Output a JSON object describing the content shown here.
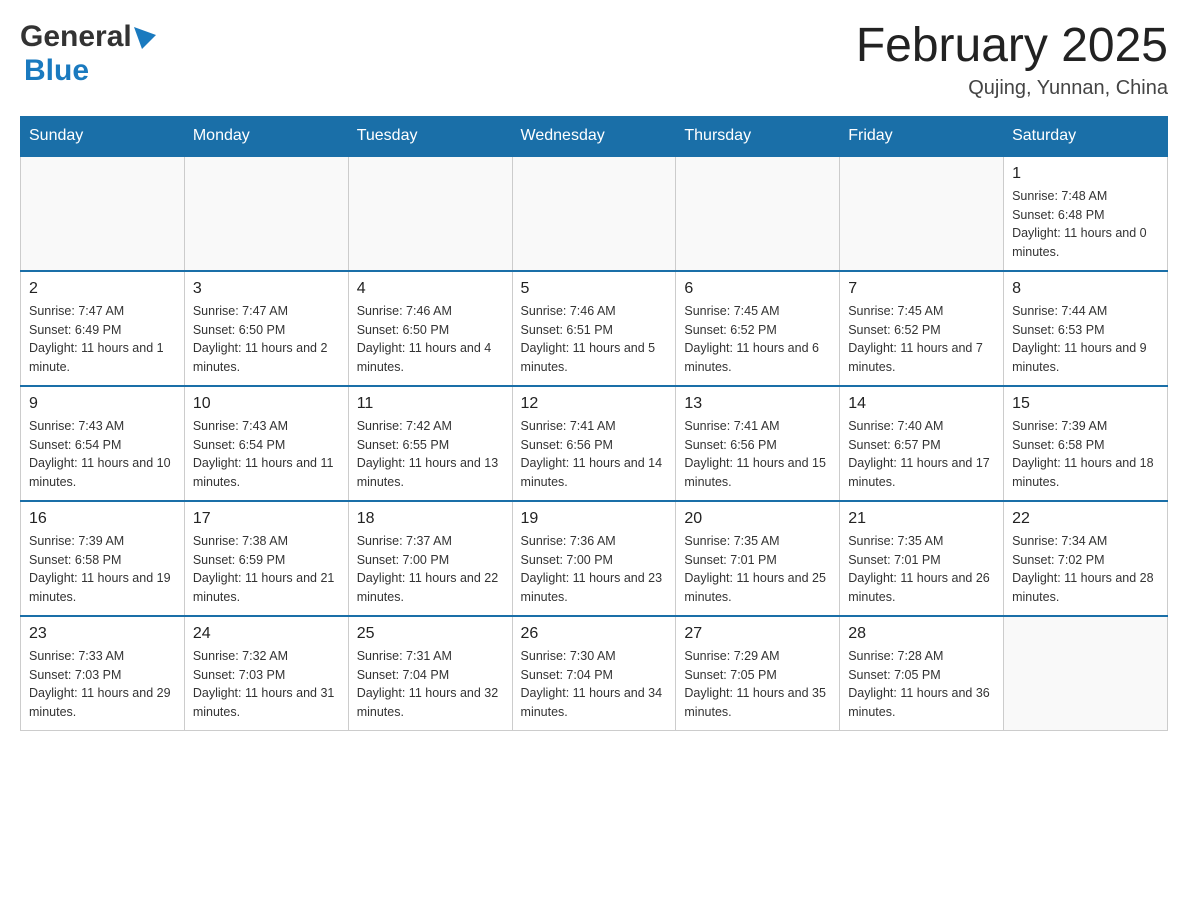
{
  "header": {
    "logo_general": "General",
    "logo_blue": "Blue",
    "month_title": "February 2025",
    "location": "Qujing, Yunnan, China"
  },
  "weekdays": [
    "Sunday",
    "Monday",
    "Tuesday",
    "Wednesday",
    "Thursday",
    "Friday",
    "Saturday"
  ],
  "weeks": [
    [
      {
        "day": "",
        "sunrise": "",
        "sunset": "",
        "daylight": "",
        "empty": true
      },
      {
        "day": "",
        "sunrise": "",
        "sunset": "",
        "daylight": "",
        "empty": true
      },
      {
        "day": "",
        "sunrise": "",
        "sunset": "",
        "daylight": "",
        "empty": true
      },
      {
        "day": "",
        "sunrise": "",
        "sunset": "",
        "daylight": "",
        "empty": true
      },
      {
        "day": "",
        "sunrise": "",
        "sunset": "",
        "daylight": "",
        "empty": true
      },
      {
        "day": "",
        "sunrise": "",
        "sunset": "",
        "daylight": "",
        "empty": true
      },
      {
        "day": "1",
        "sunrise": "Sunrise: 7:48 AM",
        "sunset": "Sunset: 6:48 PM",
        "daylight": "Daylight: 11 hours and 0 minutes.",
        "empty": false
      }
    ],
    [
      {
        "day": "2",
        "sunrise": "Sunrise: 7:47 AM",
        "sunset": "Sunset: 6:49 PM",
        "daylight": "Daylight: 11 hours and 1 minute.",
        "empty": false
      },
      {
        "day": "3",
        "sunrise": "Sunrise: 7:47 AM",
        "sunset": "Sunset: 6:50 PM",
        "daylight": "Daylight: 11 hours and 2 minutes.",
        "empty": false
      },
      {
        "day": "4",
        "sunrise": "Sunrise: 7:46 AM",
        "sunset": "Sunset: 6:50 PM",
        "daylight": "Daylight: 11 hours and 4 minutes.",
        "empty": false
      },
      {
        "day": "5",
        "sunrise": "Sunrise: 7:46 AM",
        "sunset": "Sunset: 6:51 PM",
        "daylight": "Daylight: 11 hours and 5 minutes.",
        "empty": false
      },
      {
        "day": "6",
        "sunrise": "Sunrise: 7:45 AM",
        "sunset": "Sunset: 6:52 PM",
        "daylight": "Daylight: 11 hours and 6 minutes.",
        "empty": false
      },
      {
        "day": "7",
        "sunrise": "Sunrise: 7:45 AM",
        "sunset": "Sunset: 6:52 PM",
        "daylight": "Daylight: 11 hours and 7 minutes.",
        "empty": false
      },
      {
        "day": "8",
        "sunrise": "Sunrise: 7:44 AM",
        "sunset": "Sunset: 6:53 PM",
        "daylight": "Daylight: 11 hours and 9 minutes.",
        "empty": false
      }
    ],
    [
      {
        "day": "9",
        "sunrise": "Sunrise: 7:43 AM",
        "sunset": "Sunset: 6:54 PM",
        "daylight": "Daylight: 11 hours and 10 minutes.",
        "empty": false
      },
      {
        "day": "10",
        "sunrise": "Sunrise: 7:43 AM",
        "sunset": "Sunset: 6:54 PM",
        "daylight": "Daylight: 11 hours and 11 minutes.",
        "empty": false
      },
      {
        "day": "11",
        "sunrise": "Sunrise: 7:42 AM",
        "sunset": "Sunset: 6:55 PM",
        "daylight": "Daylight: 11 hours and 13 minutes.",
        "empty": false
      },
      {
        "day": "12",
        "sunrise": "Sunrise: 7:41 AM",
        "sunset": "Sunset: 6:56 PM",
        "daylight": "Daylight: 11 hours and 14 minutes.",
        "empty": false
      },
      {
        "day": "13",
        "sunrise": "Sunrise: 7:41 AM",
        "sunset": "Sunset: 6:56 PM",
        "daylight": "Daylight: 11 hours and 15 minutes.",
        "empty": false
      },
      {
        "day": "14",
        "sunrise": "Sunrise: 7:40 AM",
        "sunset": "Sunset: 6:57 PM",
        "daylight": "Daylight: 11 hours and 17 minutes.",
        "empty": false
      },
      {
        "day": "15",
        "sunrise": "Sunrise: 7:39 AM",
        "sunset": "Sunset: 6:58 PM",
        "daylight": "Daylight: 11 hours and 18 minutes.",
        "empty": false
      }
    ],
    [
      {
        "day": "16",
        "sunrise": "Sunrise: 7:39 AM",
        "sunset": "Sunset: 6:58 PM",
        "daylight": "Daylight: 11 hours and 19 minutes.",
        "empty": false
      },
      {
        "day": "17",
        "sunrise": "Sunrise: 7:38 AM",
        "sunset": "Sunset: 6:59 PM",
        "daylight": "Daylight: 11 hours and 21 minutes.",
        "empty": false
      },
      {
        "day": "18",
        "sunrise": "Sunrise: 7:37 AM",
        "sunset": "Sunset: 7:00 PM",
        "daylight": "Daylight: 11 hours and 22 minutes.",
        "empty": false
      },
      {
        "day": "19",
        "sunrise": "Sunrise: 7:36 AM",
        "sunset": "Sunset: 7:00 PM",
        "daylight": "Daylight: 11 hours and 23 minutes.",
        "empty": false
      },
      {
        "day": "20",
        "sunrise": "Sunrise: 7:35 AM",
        "sunset": "Sunset: 7:01 PM",
        "daylight": "Daylight: 11 hours and 25 minutes.",
        "empty": false
      },
      {
        "day": "21",
        "sunrise": "Sunrise: 7:35 AM",
        "sunset": "Sunset: 7:01 PM",
        "daylight": "Daylight: 11 hours and 26 minutes.",
        "empty": false
      },
      {
        "day": "22",
        "sunrise": "Sunrise: 7:34 AM",
        "sunset": "Sunset: 7:02 PM",
        "daylight": "Daylight: 11 hours and 28 minutes.",
        "empty": false
      }
    ],
    [
      {
        "day": "23",
        "sunrise": "Sunrise: 7:33 AM",
        "sunset": "Sunset: 7:03 PM",
        "daylight": "Daylight: 11 hours and 29 minutes.",
        "empty": false
      },
      {
        "day": "24",
        "sunrise": "Sunrise: 7:32 AM",
        "sunset": "Sunset: 7:03 PM",
        "daylight": "Daylight: 11 hours and 31 minutes.",
        "empty": false
      },
      {
        "day": "25",
        "sunrise": "Sunrise: 7:31 AM",
        "sunset": "Sunset: 7:04 PM",
        "daylight": "Daylight: 11 hours and 32 minutes.",
        "empty": false
      },
      {
        "day": "26",
        "sunrise": "Sunrise: 7:30 AM",
        "sunset": "Sunset: 7:04 PM",
        "daylight": "Daylight: 11 hours and 34 minutes.",
        "empty": false
      },
      {
        "day": "27",
        "sunrise": "Sunrise: 7:29 AM",
        "sunset": "Sunset: 7:05 PM",
        "daylight": "Daylight: 11 hours and 35 minutes.",
        "empty": false
      },
      {
        "day": "28",
        "sunrise": "Sunrise: 7:28 AM",
        "sunset": "Sunset: 7:05 PM",
        "daylight": "Daylight: 11 hours and 36 minutes.",
        "empty": false
      },
      {
        "day": "",
        "sunrise": "",
        "sunset": "",
        "daylight": "",
        "empty": true
      }
    ]
  ]
}
